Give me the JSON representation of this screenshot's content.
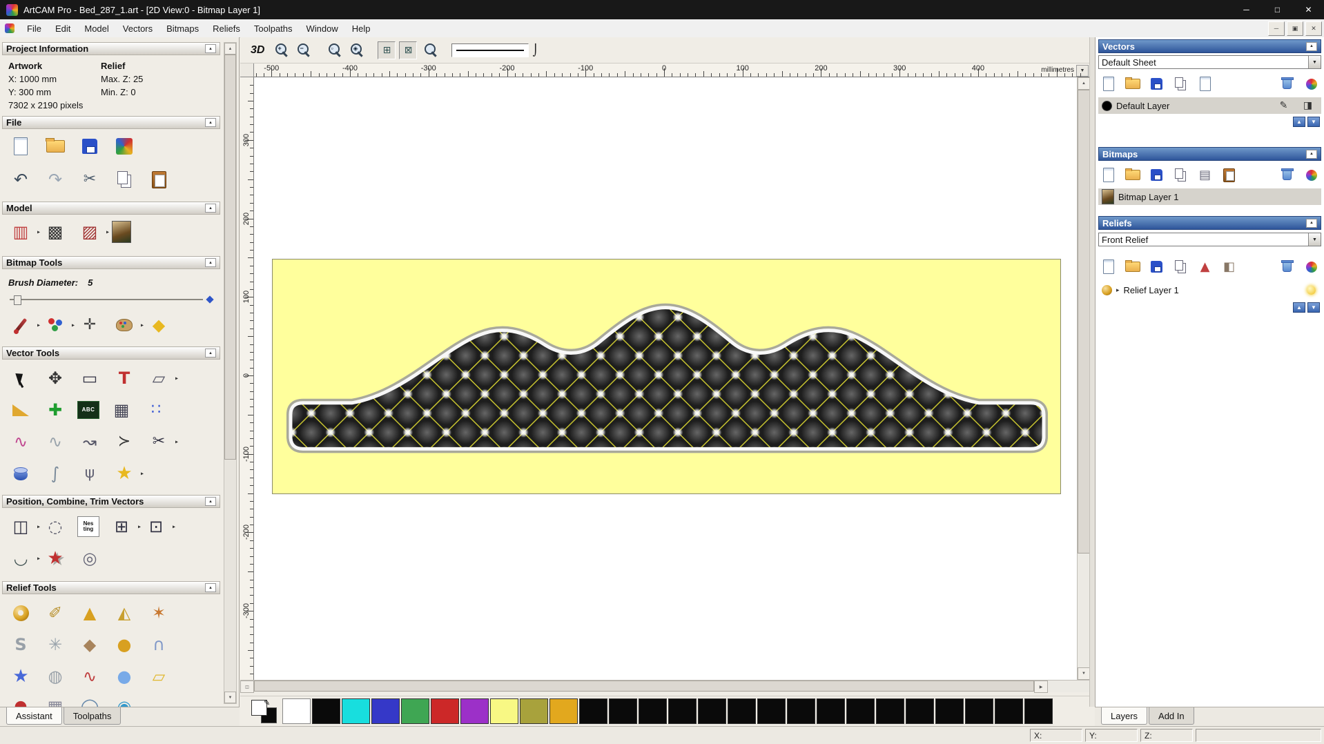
{
  "window": {
    "title": "ArtCAM Pro - Bed_287_1.art - [2D View:0 - Bitmap Layer 1]",
    "minimize_glyph": "─",
    "maximize_glyph": "□",
    "close_glyph": "✕"
  },
  "menu": {
    "items": [
      "File",
      "Edit",
      "Model",
      "Vectors",
      "Bitmaps",
      "Reliefs",
      "Toolpaths",
      "Window",
      "Help"
    ],
    "child_minimize_glyph": "─",
    "child_restore_glyph": "▣",
    "child_close_glyph": "✕"
  },
  "ui": {
    "collapse_glyph": "▲",
    "dropdown_glyph": "▼",
    "expand_glyph": "▸",
    "scroll_up_glyph": "▲",
    "scroll_down_glyph": "▼",
    "scroll_left_glyph": "◀",
    "scroll_right_glyph": "▶",
    "splitter_glyph": "◫",
    "pen_glyph": "✎",
    "move_up_glyph": "▲",
    "move_down_glyph": "▼"
  },
  "left_panel": {
    "project_information": {
      "title": "Project Information",
      "artwork_label": "Artwork",
      "relief_label": "Relief",
      "artwork_x": "X: 1000 mm",
      "relief_max_z": "Max. Z: 25",
      "artwork_y": "Y: 300 mm",
      "relief_min_z": "Min. Z: 0",
      "artwork_pixels": "7302 x 2190 pixels"
    },
    "file": {
      "title": "File"
    },
    "model": {
      "title": "Model"
    },
    "bitmap_tools": {
      "title": "Bitmap Tools",
      "brush_label": "Brush Diameter:",
      "brush_value": "5"
    },
    "vector_tools": {
      "title": "Vector Tools"
    },
    "position_combine": {
      "title": "Position, Combine, Trim Vectors"
    },
    "relief_tools": {
      "title": "Relief Tools"
    },
    "tabs": [
      {
        "label": "Assistant",
        "active": true
      },
      {
        "label": "Toolpaths",
        "active": false
      }
    ]
  },
  "canvas_toolbar": {
    "items": [
      {
        "name": "view-3d-button",
        "type": "text",
        "label": "3D"
      },
      {
        "name": "zoom-in-icon",
        "type": "mag",
        "sub": "+"
      },
      {
        "name": "zoom-out-icon",
        "type": "mag",
        "sub": "−"
      },
      {
        "type": "sep"
      },
      {
        "name": "zoom-box-icon",
        "type": "mag",
        "sub": "▫"
      },
      {
        "name": "zoom-objects-icon",
        "type": "mag",
        "sub": "◈"
      },
      {
        "type": "sep"
      },
      {
        "name": "snap-grid-toggle",
        "type": "toggle",
        "glyph": "⊞"
      },
      {
        "name": "snap-guides-toggle",
        "type": "toggle",
        "glyph": "⊠"
      },
      {
        "name": "zoom-previous-icon",
        "type": "mag",
        "sub": ""
      },
      {
        "type": "sep"
      },
      {
        "name": "line-width-control",
        "type": "line"
      },
      {
        "name": "line-width-handle",
        "type": "handle",
        "glyph": "⌡"
      }
    ]
  },
  "rulers": {
    "horizontal_labels": [
      "-500",
      "-400",
      "-300",
      "-200",
      "-100",
      "0",
      "100",
      "200",
      "300",
      "400"
    ],
    "vertical_labels": [
      "300",
      "200",
      "100",
      "0",
      "-100",
      "-200",
      "-300"
    ],
    "units": "millimetres"
  },
  "artwork": {
    "sheet_background": "#ffff9c",
    "pattern_background": "#1d1d1d",
    "lattice_line_color": "#d6d232",
    "outline_color": "#f8f8f8"
  },
  "icons": {
    "file_row1": [
      {
        "name": "new-model-icon",
        "cls": "ic-page"
      },
      {
        "name": "open-model-icon",
        "cls": "ic-folder"
      },
      {
        "name": "save-model-icon",
        "cls": "ic-disk"
      },
      {
        "name": "import-export-icon",
        "cls": "ic-art3d"
      }
    ],
    "file_row2": [
      {
        "name": "undo-icon",
        "glyph": "↶",
        "color": "#3a4a5a",
        "size": 24
      },
      {
        "name": "redo-icon",
        "glyph": "↷",
        "color": "#9aa6b4",
        "size": 24
      },
      {
        "name": "cut-icon",
        "glyph": "✂",
        "color": "#4a5a6a",
        "size": 22
      },
      {
        "name": "copy-icon",
        "cls": "ic-copy"
      },
      {
        "name": "paste-icon",
        "cls": "ic-paste"
      }
    ],
    "model_row": [
      {
        "name": "set-model-size-icon",
        "cls": "ic-modelsize",
        "glyph": "▥",
        "size": 24,
        "arrow": true
      },
      {
        "name": "model-lighting-icon",
        "glyph": "▩",
        "color": "#333",
        "size": 24
      },
      {
        "name": "model-material-icon",
        "glyph": "▨",
        "color": "#a03030",
        "size": 24,
        "arrow": true
      },
      {
        "name": "model-notes-icon",
        "cls": "ic-pic"
      }
    ],
    "bitmap_row": [
      {
        "name": "paint-brush-icon",
        "cls": "ic-brush",
        "arrow": true
      },
      {
        "name": "flood-fill-icon",
        "cls": "ic-dots",
        "arrow": true
      },
      {
        "name": "colour-picker-icon",
        "glyph": "✛",
        "color": "#444",
        "size": 22
      },
      {
        "name": "colour-palette-icon",
        "cls": "ic-palette",
        "arrow": true
      },
      {
        "name": "paint-bucket-icon",
        "glyph": "◆",
        "color": "#e8b820",
        "size": 24
      }
    ],
    "vector_row1": [
      {
        "name": "select-vectors-icon",
        "cls": "ic-cursor"
      },
      {
        "name": "transform-vectors-icon",
        "glyph": "✥",
        "color": "#333",
        "size": 24
      },
      {
        "name": "create-rectangle-icon",
        "glyph": "▭",
        "color": "#334",
        "size": 24
      },
      {
        "name": "create-text-icon",
        "glyph": "T",
        "color": "#c03030",
        "bold": true,
        "size": 24
      },
      {
        "name": "shear-vectors-icon",
        "glyph": "▱",
        "color": "#556",
        "size": 24,
        "arrow": true
      }
    ],
    "vector_row2": [
      {
        "name": "offset-vectors-icon",
        "cls": "ic-wedge"
      },
      {
        "name": "add-vector-icon",
        "glyph": "✚",
        "color": "#1f9d2f",
        "size": 24
      },
      {
        "name": "text-table-icon",
        "cls": "ic-abc",
        "text": "ABC"
      },
      {
        "name": "paste-grid-icon",
        "glyph": "▦",
        "color": "#445",
        "size": 24
      },
      {
        "name": "array-points-icon",
        "glyph": "∷",
        "color": "#3a5ad4",
        "size": 22
      }
    ],
    "vector_row3": [
      {
        "name": "create-curve-icon",
        "glyph": "∿",
        "color": "#c04890",
        "size": 24
      },
      {
        "name": "smooth-curve-icon",
        "glyph": "∿",
        "color": "#9aa4ac",
        "size": 24
      },
      {
        "name": "bezier-tool-icon",
        "glyph": "↝",
        "color": "#556",
        "size": 24
      },
      {
        "name": "polyline-tool-icon",
        "glyph": "≻",
        "color": "#333",
        "size": 22
      },
      {
        "name": "trim-vectors-icon",
        "glyph": "✂",
        "color": "#334",
        "size": 22,
        "arrow": true
      }
    ],
    "vector_row4": [
      {
        "name": "extrude-vector-icon",
        "cls": "ic-cyl"
      },
      {
        "name": "curve-editor-icon",
        "glyph": "∫",
        "color": "#7a8a9a",
        "size": 24
      },
      {
        "name": "node-editor-icon",
        "glyph": "ψ",
        "color": "#667",
        "size": 22
      },
      {
        "name": "star-tool-icon",
        "glyph": "★",
        "color": "#e8b820",
        "size": 26,
        "arrow": true
      }
    ],
    "position_row1": [
      {
        "name": "align-vectors-icon",
        "glyph": "◫",
        "color": "#334",
        "size": 24,
        "arrow": true
      },
      {
        "name": "circular-array-icon",
        "glyph": "◌",
        "color": "#556",
        "size": 24
      },
      {
        "name": "nesting-icon",
        "cls": "ic-nesting",
        "text": "Nes ting"
      },
      {
        "name": "block-array-icon",
        "glyph": "⊞",
        "color": "#334",
        "size": 24,
        "arrow": true
      },
      {
        "name": "copy-along-icon",
        "glyph": "⊡",
        "color": "#334",
        "size": 24,
        "arrow": true
      }
    ],
    "position_row2": [
      {
        "name": "join-vectors-icon",
        "glyph": "◡",
        "color": "#455",
        "size": 24,
        "arrow": true
      },
      {
        "name": "stamp-vectors-icon",
        "cls": "ic-stamp",
        "glyph": "★",
        "size": 26
      },
      {
        "name": "spiral-tool-icon",
        "glyph": "◎",
        "color": "#667",
        "size": 24
      }
    ],
    "relief_row1": [
      {
        "name": "shape-editor-icon",
        "cls": "ic-donut"
      },
      {
        "name": "smooth-relief-icon",
        "glyph": "✐",
        "color": "#b8902c",
        "size": 24
      },
      {
        "name": "add-clay-icon",
        "glyph": "▲",
        "color": "#d8a020",
        "size": 24
      },
      {
        "name": "angled-relief-icon",
        "glyph": "◭",
        "color": "#c8a030",
        "size": 24
      },
      {
        "name": "relief-spin-icon",
        "glyph": "✶",
        "color": "#c87830",
        "size": 24
      }
    ],
    "relief_row2": [
      {
        "name": "sculpting-icon",
        "glyph": "S",
        "color": "#98a0a8",
        "bold": true,
        "size": 24
      },
      {
        "name": "weave-relief-icon",
        "glyph": "✳",
        "color": "#9aa4ac",
        "size": 24
      },
      {
        "name": "smudge-tool-icon",
        "glyph": "◆",
        "color": "#a8845c",
        "size": 24
      },
      {
        "name": "deposit-relief-icon",
        "glyph": "●",
        "color": "#d8a020",
        "size": 24
      },
      {
        "name": "arch-relief-icon",
        "glyph": "∩",
        "color": "#8098c8",
        "size": 24
      }
    ],
    "relief_row3": [
      {
        "name": "star-relief-icon",
        "glyph": "★",
        "color": "#4868d8",
        "size": 26
      },
      {
        "name": "texture-relief-icon",
        "glyph": "◍",
        "color": "#98a0a8",
        "size": 24
      },
      {
        "name": "wave-relief-icon",
        "glyph": "∿",
        "color": "#c04040",
        "size": 24
      },
      {
        "name": "glow-relief-icon",
        "glyph": "●",
        "color": "#78aae8",
        "size": 24
      },
      {
        "name": "offset-relief-icon",
        "glyph": "▱",
        "color": "#e0b830",
        "size": 24
      }
    ],
    "relief_row4": [
      {
        "name": "dot-relief-icon",
        "glyph": "●",
        "color": "#c03030",
        "size": 22
      },
      {
        "name": "mesh-relief-icon",
        "glyph": "▦",
        "color": "#889",
        "size": 24
      },
      {
        "name": "sphere-relief-icon",
        "glyph": "◯",
        "color": "#6688aa",
        "size": 24
      },
      {
        "name": "globe-relief-icon",
        "glyph": "◉",
        "color": "#3399cc",
        "size": 24
      }
    ],
    "vectors_toolbar": [
      {
        "name": "new-sheet-icon",
        "cls": "ic-page"
      },
      {
        "name": "open-vectors-icon",
        "cls": "ic-folder"
      },
      {
        "name": "save-vectors-icon",
        "cls": "ic-disk"
      },
      {
        "name": "import-vectors-icon",
        "cls": "ic-copy"
      },
      {
        "name": "paste-vectors-icon",
        "cls": "ic-page"
      },
      {
        "spacer": true
      },
      {
        "name": "delete-vector-layer-icon",
        "cls": "ic-trash"
      },
      {
        "name": "vector-layer-options-icon",
        "cls": "ic-star-col"
      }
    ],
    "vectors_layer_tools": [
      {
        "name": "layer-edit-icon",
        "glyph": "✎",
        "color": "#333",
        "size": 14
      },
      {
        "name": "layer-contrast-icon",
        "glyph": "◨",
        "color": "#333",
        "size": 14
      }
    ],
    "bitmaps_toolbar": [
      {
        "name": "new-bitmap-icon",
        "cls": "ic-page"
      },
      {
        "name": "open-bitmap-icon",
        "cls": "ic-folder"
      },
      {
        "name": "save-bitmap-icon",
        "cls": "ic-disk"
      },
      {
        "name": "import-bitmap-icon",
        "cls": "ic-copy"
      },
      {
        "name": "bitmap-adjust-icon",
        "glyph": "▤",
        "color": "#667",
        "size": 18
      },
      {
        "name": "merge-bitmap-icon",
        "cls": "ic-paste"
      },
      {
        "spacer": true
      },
      {
        "name": "delete-bitmap-layer-icon",
        "cls": "ic-trash"
      },
      {
        "name": "bitmap-layer-options-icon",
        "cls": "ic-star-col"
      }
    ],
    "reliefs_toolbar": [
      {
        "name": "new-relief-icon",
        "cls": "ic-page"
      },
      {
        "name": "open-relief-icon",
        "cls": "ic-folder"
      },
      {
        "name": "save-relief-icon",
        "cls": "ic-disk"
      },
      {
        "name": "import-relief-icon",
        "cls": "ic-copy"
      },
      {
        "name": "relief-3d-icon",
        "glyph": "▲",
        "color": "#c04040",
        "size": 18
      },
      {
        "name": "relief-wrap-icon",
        "glyph": "◧",
        "color": "#887766",
        "size": 18
      },
      {
        "spacer": true
      },
      {
        "name": "delete-relief-layer-icon",
        "cls": "ic-trash"
      },
      {
        "name": "relief-layer-options-icon",
        "cls": "ic-star-col"
      }
    ]
  },
  "right_panel": {
    "vectors": {
      "title": "Vectors",
      "sheet": "Default Sheet",
      "layer": "Default Layer"
    },
    "bitmaps": {
      "title": "Bitmaps",
      "layer": "Bitmap Layer 1"
    },
    "reliefs": {
      "title": "Reliefs",
      "relief": "Front Relief",
      "layer": "Relief Layer 1"
    },
    "tabs": [
      {
        "label": "Layers",
        "active": true
      },
      {
        "label": "Add In",
        "active": false
      }
    ]
  },
  "palette": {
    "swatches": [
      {
        "name": "primary-secondary-colour",
        "special": true
      },
      {
        "name": "colour-white",
        "hex": "#ffffff"
      },
      {
        "name": "colour-black",
        "hex": "#0a0a0a"
      },
      {
        "name": "colour-cyan",
        "hex": "#18dede"
      },
      {
        "name": "colour-blue",
        "hex": "#3538c8"
      },
      {
        "name": "colour-green",
        "hex": "#3fa653"
      },
      {
        "name": "colour-red",
        "hex": "#cc2828"
      },
      {
        "name": "colour-magenta",
        "hex": "#9c30c8"
      },
      {
        "name": "colour-yellow",
        "hex": "#f8f884"
      },
      {
        "name": "colour-olive",
        "hex": "#a8a23c"
      },
      {
        "name": "colour-gold",
        "hex": "#e2a81e"
      },
      {
        "name": "colour-black-extra",
        "hex": "#0a0a0a",
        "repeat": 16
      }
    ]
  },
  "status_bar": {
    "x_label": "X:",
    "y_label": "Y:",
    "z_label": "Z:"
  }
}
